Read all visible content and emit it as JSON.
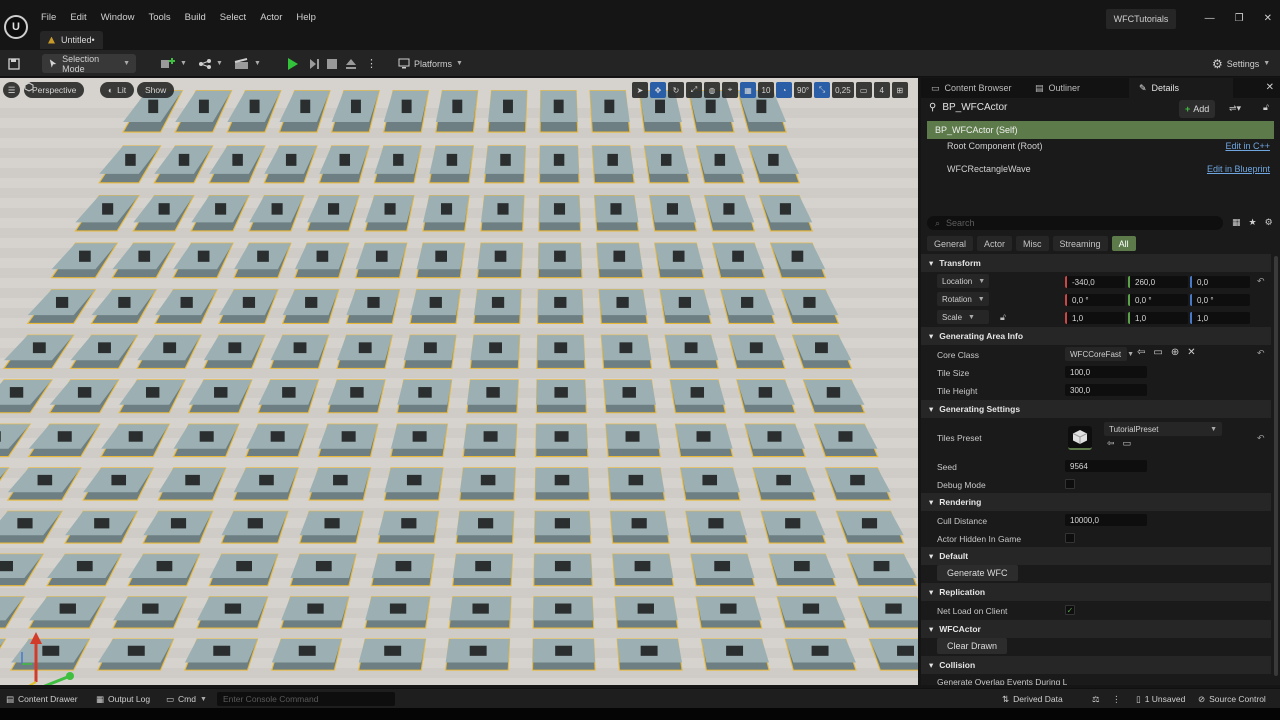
{
  "menubar": {
    "logo": "U",
    "items": [
      "File",
      "Edit",
      "Window",
      "Tools",
      "Build",
      "Select",
      "Actor",
      "Help"
    ],
    "doc_tab": "Untitled•",
    "project_name": "WFCTutorials",
    "window_controls": [
      "—",
      "❐",
      "✕"
    ]
  },
  "toolbar": {
    "save_icon": "save-icon",
    "selection_mode": "Selection Mode",
    "platforms": "Platforms",
    "settings": "Settings"
  },
  "viewport": {
    "perspective": "Perspective",
    "lit": "Lit",
    "show": "Show",
    "grid_snap": "10",
    "rotation_snap": "90°",
    "scale_snap": "0,25",
    "camera_speed": "4",
    "colors": {
      "floor_light": "#d6d3ce",
      "floor_dark": "#bcb8b2",
      "tile": "#8fa3a6",
      "tile_top": "#9cb0b3",
      "selection": "#e8b83a"
    }
  },
  "panel": {
    "tabs": [
      {
        "label": "Content Browser",
        "icon": "folder-icon"
      },
      {
        "label": "Outliner",
        "icon": "outliner-icon"
      },
      {
        "label": "Details",
        "icon": "pencil-icon"
      }
    ],
    "close": "✕",
    "actor_name": "BP_WFCActor",
    "add_label": "Add",
    "components": {
      "self": "BP_WFCActor (Self)",
      "root": "Root Component (Root)",
      "root_link": "Edit in C++",
      "wave": "WFCRectangleWave",
      "wave_link": "Edit in Blueprint"
    },
    "search_placeholder": "Search",
    "filter_tabs": [
      "General",
      "Actor",
      "Misc",
      "Streaming",
      "All"
    ],
    "sections": {
      "transform": "Transform",
      "area": "Generating Area Info",
      "settings": "Generating Settings",
      "rendering": "Rendering",
      "default": "Default",
      "replication": "Replication",
      "wfcactor": "WFCActor",
      "collision": "Collision"
    },
    "transform": {
      "location_label": "Location",
      "location": [
        "-340,0",
        "260,0",
        "0,0"
      ],
      "rotation_label": "Rotation",
      "rotation": [
        "0,0 °",
        "0,0 °",
        "0,0 °"
      ],
      "scale_label": "Scale",
      "scale": [
        "1,0",
        "1,0",
        "1,0"
      ]
    },
    "area": {
      "core_class_label": "Core Class",
      "core_class": "WFCCoreFast",
      "tile_size_label": "Tile Size",
      "tile_size": "100,0",
      "tile_height_label": "Tile Height",
      "tile_height": "300,0"
    },
    "settings": {
      "tiles_preset_label": "Tiles Preset",
      "tiles_preset": "TutorialPreset",
      "seed_label": "Seed",
      "seed": "9564",
      "debug_label": "Debug Mode"
    },
    "rendering": {
      "cull_label": "Cull Distance",
      "cull": "10000,0",
      "hidden_label": "Actor Hidden In Game"
    },
    "default_button": "Generate WFC",
    "replication": {
      "net_load_label": "Net Load on Client",
      "net_load_checked": "✓"
    },
    "wfcactor_button": "Clear Drawn",
    "collision_cut": "Generate Overlap Events During L"
  },
  "statusbar": {
    "content_drawer": "Content Drawer",
    "output_log": "Output Log",
    "cmd": "Cmd",
    "console_placeholder": "Enter Console Command",
    "derived_data": "Derived Data",
    "unsaved": "1 Unsaved",
    "source_control": "Source Control"
  }
}
